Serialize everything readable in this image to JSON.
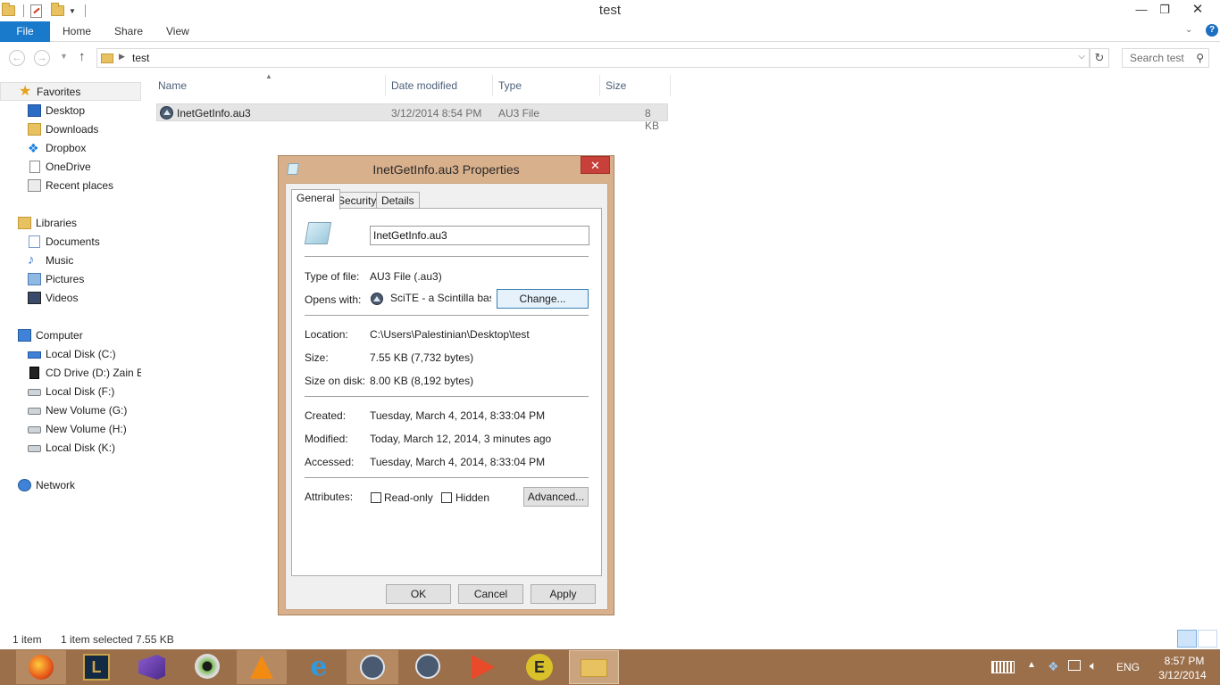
{
  "window": {
    "title": "test",
    "minimize_glyph": "—",
    "maximize_glyph": "❐",
    "close_glyph": "✕"
  },
  "ribbon": {
    "file_label": "File",
    "tabs": [
      "Home",
      "Share",
      "View"
    ],
    "help_glyph": "?"
  },
  "address": {
    "path": "test",
    "search_placeholder": "Search test"
  },
  "nav": {
    "favorites_label": "Favorites",
    "favorites": [
      "Desktop",
      "Downloads",
      "Dropbox",
      "OneDrive",
      "Recent places"
    ],
    "libraries_label": "Libraries",
    "libraries": [
      "Documents",
      "Music",
      "Pictures",
      "Videos"
    ],
    "computer_label": "Computer",
    "drives": [
      "Local Disk (C:)",
      "CD Drive (D:) Zain Bro",
      "Local Disk (F:)",
      "New Volume (G:)",
      "New Volume (H:)",
      "Local Disk (K:)"
    ],
    "network_label": "Network"
  },
  "filelist": {
    "columns": [
      "Name",
      "Date modified",
      "Type",
      "Size"
    ],
    "rows": [
      {
        "name": "InetGetInfo.au3",
        "date": "3/12/2014 8:54 PM",
        "type": "AU3 File",
        "size": "8 KB"
      }
    ]
  },
  "status": {
    "count": "1 item",
    "selected": "1 item selected  7.55 KB"
  },
  "dialog": {
    "title": "InetGetInfo.au3 Properties",
    "close_glyph": "✕",
    "tabs": [
      "General",
      "Security",
      "Details"
    ],
    "filename": "InetGetInfo.au3",
    "type_label": "Type of file:",
    "type_value": "AU3 File (.au3)",
    "opens_label": "Opens with:",
    "opens_value": "SciTE - a Scintilla based",
    "change_label": "Change...",
    "location_label": "Location:",
    "location_value": "C:\\Users\\Palestinian\\Desktop\\test",
    "size_label": "Size:",
    "size_value": "7.55 KB (7,732 bytes)",
    "size_disk_label": "Size on disk:",
    "size_disk_value": "8.00 KB (8,192 bytes)",
    "created_label": "Created:",
    "created_value": "Tuesday, March 4, 2014, 8:33:04 PM",
    "modified_label": "Modified:",
    "modified_value": "Today, March 12, 2014, 3 minutes ago",
    "accessed_label": "Accessed:",
    "accessed_value": "Tuesday, March 4, 2014, 8:33:04 PM",
    "attributes_label": "Attributes:",
    "readonly_label": "Read-only",
    "hidden_label": "Hidden",
    "advanced_label": "Advanced...",
    "ok_label": "OK",
    "cancel_label": "Cancel",
    "apply_label": "Apply"
  },
  "taskbar": {
    "apps": [
      "firefox-icon",
      "league-icon",
      "visual-studio-icon",
      "eye-icon",
      "vlc-icon",
      "internet-explorer-icon",
      "autoit-icon",
      "autoit-icon",
      "play-icon",
      "e-icon",
      "file-explorer-icon"
    ],
    "language": "ENG",
    "time": "8:57 PM",
    "date": "3/12/2014"
  },
  "colors": {
    "file_tab": "#1979ca",
    "dialog_frame": "#d9b08c",
    "close_button": "#c7403a",
    "taskbar": "#9b6f4a"
  }
}
